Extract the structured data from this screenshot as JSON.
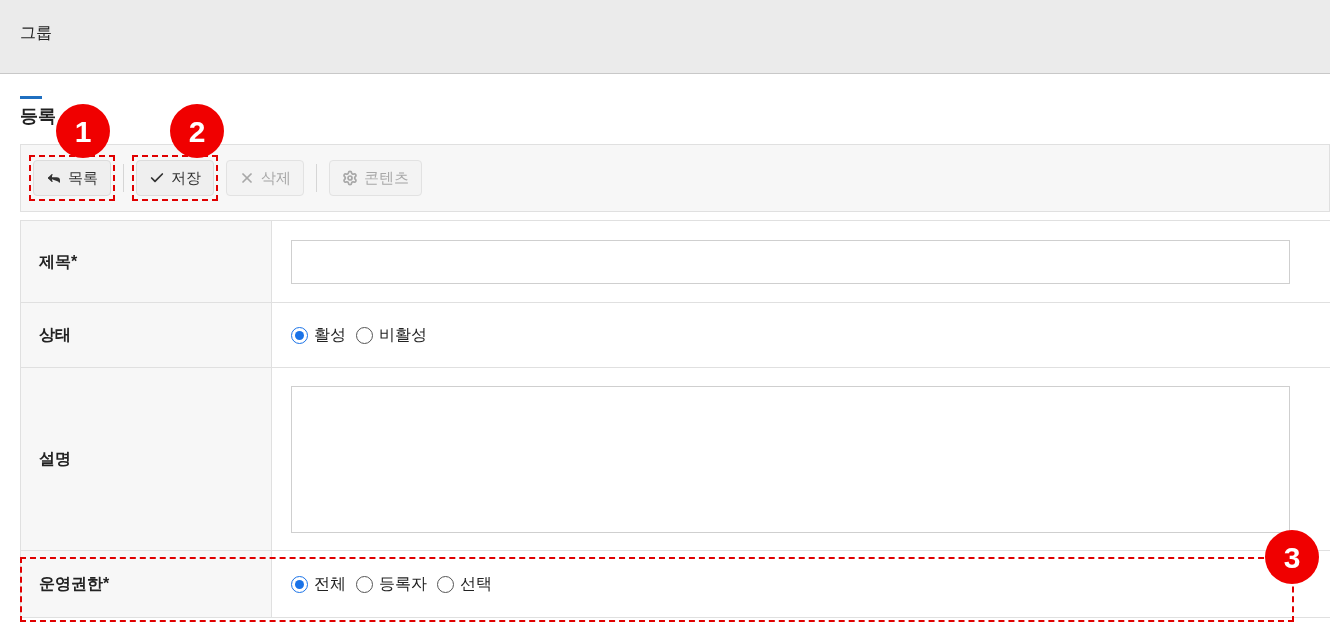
{
  "header": {
    "title": "그룹"
  },
  "section": {
    "title": "등록"
  },
  "toolbar": [
    {
      "kind": "back",
      "label": "목록",
      "disabled": false
    },
    {
      "kind": "save",
      "label": "저장",
      "disabled": false
    },
    {
      "kind": "delete",
      "label": "삭제",
      "disabled": true
    },
    {
      "kind": "content",
      "label": "콘텐츠",
      "disabled": true
    }
  ],
  "form": [
    {
      "kind": "text",
      "label": "제목*"
    },
    {
      "kind": "radio",
      "label": "상태",
      "options": [
        {
          "label": "활성",
          "selected": true
        },
        {
          "label": "비활성",
          "selected": false
        }
      ]
    },
    {
      "kind": "textarea",
      "label": "설명"
    },
    {
      "kind": "radio",
      "label": "운영권한*",
      "options": [
        {
          "label": "전체",
          "selected": true
        },
        {
          "label": "등록자",
          "selected": false
        },
        {
          "label": "선택",
          "selected": false
        }
      ]
    }
  ],
  "annotations": [
    {
      "label": "1"
    },
    {
      "label": "2"
    },
    {
      "label": "3"
    }
  ]
}
